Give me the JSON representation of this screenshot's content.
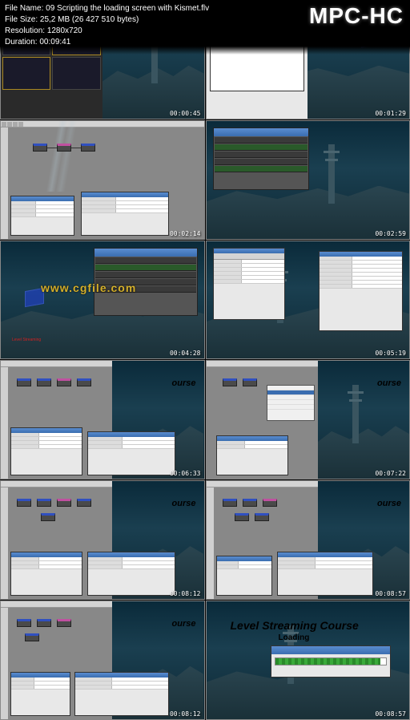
{
  "header": {
    "filename_label": "File Name:",
    "filename": "09 Scripting the loading screen with Kismet.flv",
    "filesize_label": "File Size:",
    "filesize": "25,2 MB (26 427 510 bytes)",
    "resolution_label": "Resolution:",
    "resolution": "1280x720",
    "duration_label": "Duration:",
    "duration": "00:09:41",
    "brand": "MPC-HC"
  },
  "thumbs": [
    {
      "time": "00:00:45"
    },
    {
      "time": "00:01:29"
    },
    {
      "time": "00:02:14"
    },
    {
      "time": "00:02:59"
    },
    {
      "time": "00:04:28"
    },
    {
      "time": "00:05:19"
    },
    {
      "time": "00:06:33"
    },
    {
      "time": "00:07:22"
    },
    {
      "time": "00:08:12"
    },
    {
      "time": "00:08:57"
    }
  ],
  "overlay": {
    "watermark": "www.cgfile.com",
    "course_text": "Level Streaming Course",
    "course_partial": "ourse",
    "loading": "Loading"
  }
}
